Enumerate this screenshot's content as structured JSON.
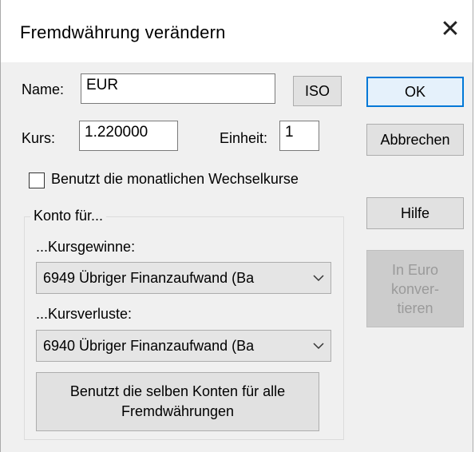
{
  "window": {
    "title": "Fremdwährung verändern"
  },
  "name": {
    "label": "Name:",
    "value": "EUR",
    "iso_button": "ISO"
  },
  "rate": {
    "label": "Kurs:",
    "value": "1.220000",
    "unit_label": "Einheit:",
    "unit_value": "1"
  },
  "monthly": {
    "label": "Benutzt die monatlichen Wechselkurse",
    "checked": false
  },
  "accounts": {
    "group_label": "Konto für...",
    "gains_label": "...Kursgewinne:",
    "gains_value": "6949 Übriger Finanzaufwand (Ba",
    "losses_label": "...Kursverluste:",
    "losses_value": "6940 Übriger Finanzaufwand (Ba",
    "same_button": [
      "Benutzt die selben Konten für alle",
      "Fremdwährungen"
    ]
  },
  "buttons": {
    "ok": "OK",
    "cancel": "Abbrechen",
    "help": "Hilfe",
    "euro": [
      "In Euro",
      "konver-",
      "tieren"
    ]
  }
}
